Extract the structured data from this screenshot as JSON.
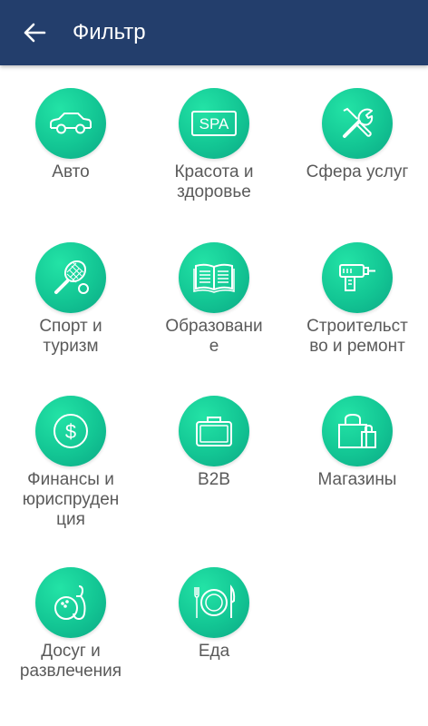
{
  "header": {
    "title": "Фильтр",
    "back_icon": "arrow-left-icon"
  },
  "colors": {
    "appbar": "#233e6c",
    "accent": "#16cc98",
    "label": "#5a5a5a"
  },
  "categories": [
    {
      "label": "Авто",
      "icon": "car-icon"
    },
    {
      "label": "Красота и\nздоровье",
      "icon": "spa-icon",
      "icon_text": "SPA"
    },
    {
      "label": "Сфера услуг",
      "icon": "tools-icon"
    },
    {
      "label": "Спорт и\nтуризм",
      "icon": "tennis-icon"
    },
    {
      "label": "Образовани\nе",
      "icon": "book-icon"
    },
    {
      "label": "Строительст\nво и ремонт",
      "icon": "drill-icon"
    },
    {
      "label": "Финансы и\nюриспруден\nция",
      "icon": "coin-icon",
      "icon_text": "$"
    },
    {
      "label": "B2B",
      "icon": "briefcase-icon"
    },
    {
      "label": "Магазины",
      "icon": "shopping-bags-icon"
    },
    {
      "label": "Досуг и\nразвлечения",
      "icon": "bowling-icon"
    },
    {
      "label": "Еда",
      "icon": "plate-icon"
    }
  ]
}
